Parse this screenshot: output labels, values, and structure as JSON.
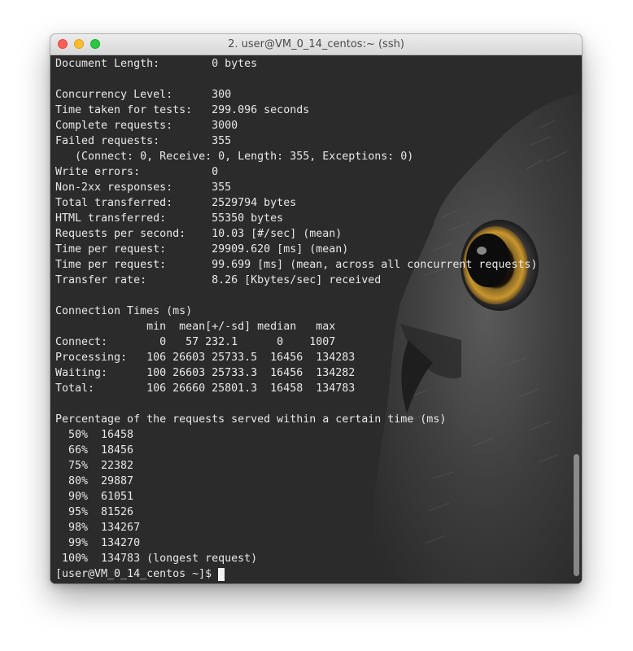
{
  "window": {
    "title": "2. user@VM_0_14_centos:~ (ssh)"
  },
  "terminal": {
    "lines": [
      "Document Length:        0 bytes",
      "",
      "Concurrency Level:      300",
      "Time taken for tests:   299.096 seconds",
      "Complete requests:      3000",
      "Failed requests:        355",
      "   (Connect: 0, Receive: 0, Length: 355, Exceptions: 0)",
      "Write errors:           0",
      "Non-2xx responses:      355",
      "Total transferred:      2529794 bytes",
      "HTML transferred:       55350 bytes",
      "Requests per second:    10.03 [#/sec] (mean)",
      "Time per request:       29909.620 [ms] (mean)",
      "Time per request:       99.699 [ms] (mean, across all concurrent requests)",
      "Transfer rate:          8.26 [Kbytes/sec] received",
      "",
      "Connection Times (ms)",
      "              min  mean[+/-sd] median   max",
      "Connect:        0   57 232.1      0    1007",
      "Processing:   106 26603 25733.5  16456  134283",
      "Waiting:      100 26603 25733.3  16456  134282",
      "Total:        106 26660 25801.3  16458  134783",
      "",
      "Percentage of the requests served within a certain time (ms)",
      "  50%  16458",
      "  66%  18456",
      "  75%  22382",
      "  80%  29887",
      "  90%  61051",
      "  95%  81526",
      "  98%  134267",
      "  99%  134270",
      " 100%  134783 (longest request)"
    ],
    "prompt": "[user@VM_0_14_centos ~]$"
  },
  "colors": {
    "terminal_bg": "#2b2b2b",
    "terminal_text": "#e8e8e8",
    "close": "#fc5f57",
    "minimize": "#fdbc2e",
    "zoom": "#28c840",
    "owl_eye": "#c8962e"
  }
}
